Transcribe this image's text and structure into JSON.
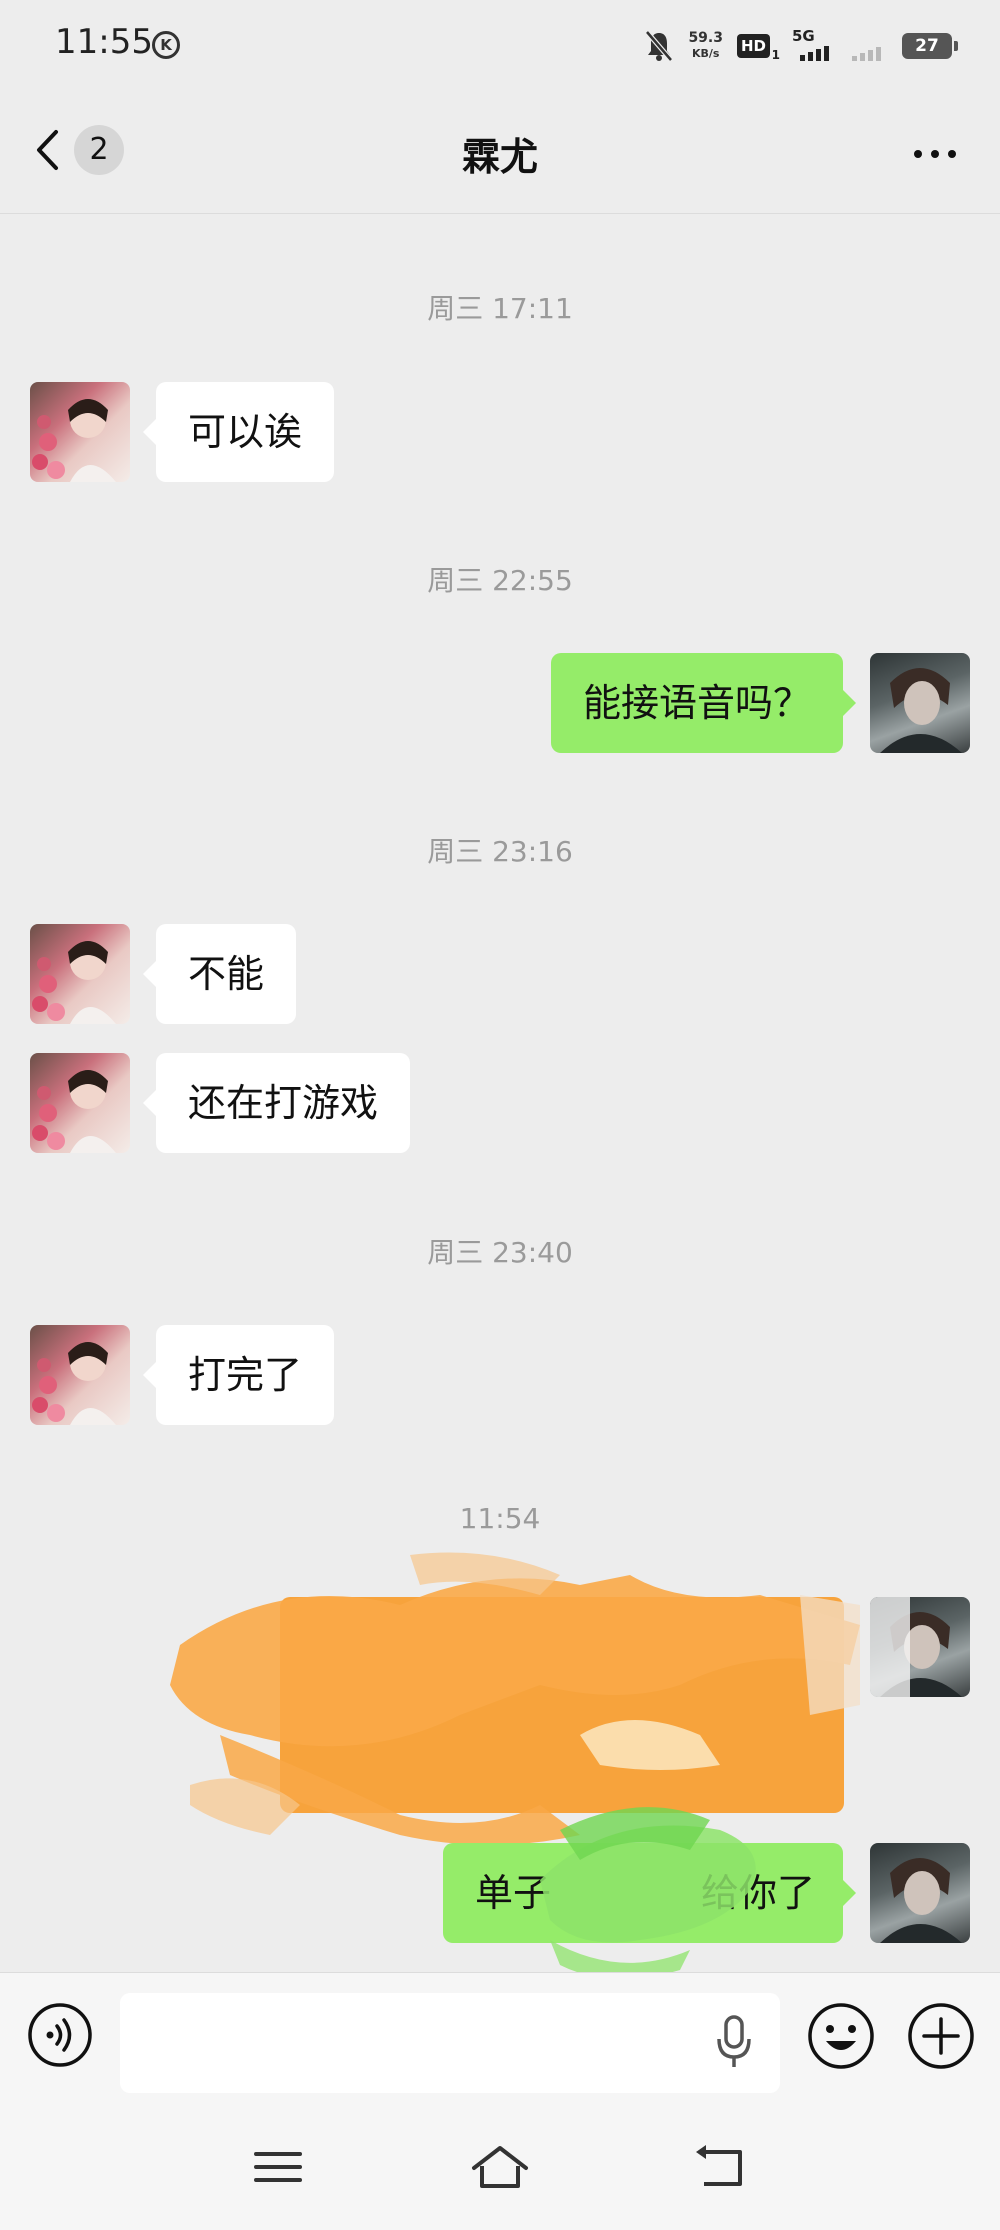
{
  "status_bar": {
    "time": "11:55",
    "k_badge": "K",
    "net_speed_value": "59.3",
    "net_speed_unit": "KB/s",
    "hd_label": "HD",
    "hd_sub": "1",
    "network": "5G",
    "battery": "27"
  },
  "header": {
    "back_badge": "2",
    "title": "霖尤",
    "more_icon": "more-dots-icon"
  },
  "messages": [
    {
      "type": "time",
      "text": "周三 17:11"
    },
    {
      "type": "in",
      "text": "可以诶"
    },
    {
      "type": "time",
      "text": "周三 22:55"
    },
    {
      "type": "out",
      "text": "能接语音吗？"
    },
    {
      "type": "time",
      "text": "周三 23:16"
    },
    {
      "type": "in",
      "text": "不能"
    },
    {
      "type": "in",
      "text": "还在打游戏"
    },
    {
      "type": "time",
      "text": "周三 23:40"
    },
    {
      "type": "in",
      "text": "打完了"
    },
    {
      "type": "time",
      "text": "11:54"
    },
    {
      "type": "out",
      "text": "",
      "redacted": true
    },
    {
      "type": "out",
      "text": "单子",
      "text_tail": "给你了",
      "partially_redacted": true
    }
  ],
  "input_bar": {
    "placeholder": "",
    "voice_icon": "voice-mode-icon",
    "mic_icon": "microphone-icon",
    "emoji_icon": "emoji-icon",
    "plus_icon": "plus-icon"
  },
  "colors": {
    "background": "#ededed",
    "bubble_in": "#ffffff",
    "bubble_out": "#95ec69",
    "redaction_orange": "#f7a33c",
    "timestamp": "#9a9a9a"
  }
}
